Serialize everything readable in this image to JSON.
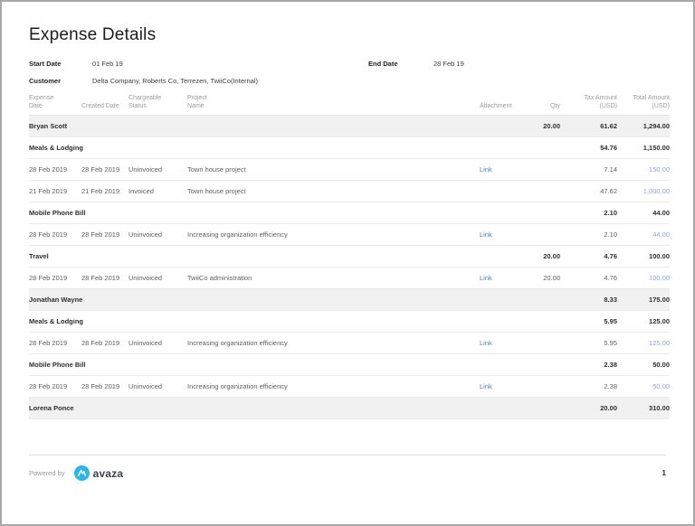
{
  "header": {
    "title": "Expense Details"
  },
  "filters": {
    "start_date": {
      "label": "Start Date",
      "value": "01 Feb 19"
    },
    "end_date": {
      "label": "End Date",
      "value": "28 Feb 19"
    },
    "customer": {
      "label": "Customer",
      "value": "Delta Company, Roberts Co, Terrezen, TwiiCo(Internal)"
    }
  },
  "table": {
    "columns": {
      "expense_date": "Expense\nDate",
      "created_date": "Created Date",
      "chargeable_status": "Chargeable\nStatus",
      "project_name": "Project\nName",
      "attachment": "Attachment",
      "qty": "Qty",
      "tax_amount": "Tax Amount\n(USD)",
      "total_amount": "Total Amount\n(USD)"
    },
    "rows": [
      {
        "type": "person",
        "name": "Bryan Scott",
        "qty": "20.00",
        "tax": "61.62",
        "total": "1,294.00"
      },
      {
        "type": "category",
        "name": "Meals & Lodging",
        "qty": "",
        "tax": "54.76",
        "total": "1,150.00"
      },
      {
        "type": "detail",
        "expense_date": "28 Feb 2019",
        "created_date": "28 Feb 2019",
        "status": "Uninvoiced",
        "project": "Town house project",
        "attachment": "Link",
        "qty": "",
        "tax": "7.14",
        "total": "150.00"
      },
      {
        "type": "detail",
        "expense_date": "21 Feb 2019",
        "created_date": "21 Feb 2019",
        "status": "Invoiced",
        "project": "Town house project",
        "attachment": "",
        "qty": "",
        "tax": "47.62",
        "total": "1,000.00"
      },
      {
        "type": "category",
        "name": "Mobile Phone Bill",
        "qty": "",
        "tax": "2.10",
        "total": "44.00"
      },
      {
        "type": "detail",
        "expense_date": "28 Feb 2019",
        "created_date": "28 Feb 2019",
        "status": "Uninvoiced",
        "project": "Increasing organization efficiency",
        "attachment": "Link",
        "qty": "",
        "tax": "2.10",
        "total": "44.00"
      },
      {
        "type": "category",
        "name": "Travel",
        "qty": "20.00",
        "tax": "4.76",
        "total": "100.00"
      },
      {
        "type": "detail",
        "expense_date": "28 Feb 2019",
        "created_date": "28 Feb 2019",
        "status": "Uninvoiced",
        "project": "TwiiCo administration",
        "attachment": "Link",
        "qty": "20.00",
        "tax": "4.76",
        "total": "100.00"
      },
      {
        "type": "person",
        "name": "Jonathan Wayne",
        "qty": "",
        "tax": "8.33",
        "total": "175.00"
      },
      {
        "type": "category",
        "name": "Meals & Lodging",
        "qty": "",
        "tax": "5.95",
        "total": "125.00"
      },
      {
        "type": "detail",
        "expense_date": "28 Feb 2019",
        "created_date": "28 Feb 2019",
        "status": "Uninvoiced",
        "project": "Increasing organization efficiency",
        "attachment": "Link",
        "qty": "",
        "tax": "5.95",
        "total": "125.00"
      },
      {
        "type": "category",
        "name": "Mobile Phone Bill",
        "qty": "",
        "tax": "2.38",
        "total": "50.00"
      },
      {
        "type": "detail",
        "expense_date": "28 Feb 2019",
        "created_date": "28 Feb 2019",
        "status": "Uninvoiced",
        "project": "Increasing organization efficiency",
        "attachment": "Link",
        "qty": "",
        "tax": "2.38",
        "total": "50.00"
      },
      {
        "type": "person",
        "name": "Lorena Ponce",
        "qty": "",
        "tax": "20.00",
        "total": "310.00"
      }
    ]
  },
  "footer": {
    "powered_by": "Powered by",
    "brand": "avaza",
    "page_number": "1"
  },
  "colors": {
    "link_blue": "#4a7bc4",
    "amount_blue": "#8ea3d6",
    "logo_cyan": "#29b8e5",
    "group_row_bg": "#f1f1f1"
  }
}
